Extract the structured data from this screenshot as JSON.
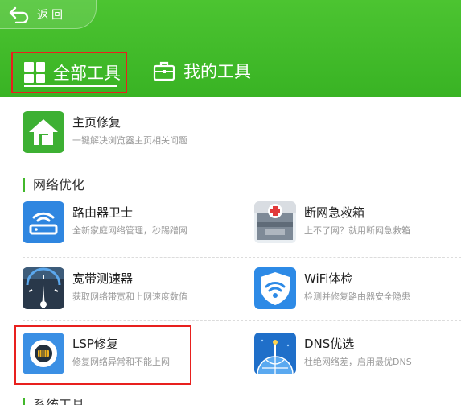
{
  "header": {
    "back_label": "返回",
    "tabs": [
      {
        "label": "全部工具",
        "selected": true
      },
      {
        "label": "我的工具",
        "selected": false
      }
    ]
  },
  "homepage_repair": {
    "name": "主页修复",
    "desc": "一键解决浏览器主页相关问题"
  },
  "sections": {
    "network": "网络优化",
    "system": "系统工具"
  },
  "network_tools": [
    {
      "name": "路由器卫士",
      "desc": "全新家庭网络管理，秒踢蹭网",
      "icon": "router-icon"
    },
    {
      "name": "断网急救箱",
      "desc": "上不了网？就用断网急救箱",
      "icon": "first-aid-kit-icon"
    },
    {
      "name": "宽带测速器",
      "desc": "获取网络带宽和上网速度数值",
      "icon": "speedometer-icon"
    },
    {
      "name": "WiFi体检",
      "desc": "检测并修复路由器安全隐患",
      "icon": "wifi-shield-icon"
    },
    {
      "name": "LSP修复",
      "desc": "修复网络异常和不能上网",
      "icon": "chip-icon"
    },
    {
      "name": "DNS优选",
      "desc": "杜绝网络差，启用最优DNS",
      "icon": "globe-icon"
    }
  ],
  "colors": {
    "header_green": "#3fb82a",
    "highlight_red": "#e8201e",
    "accent_blue": "#2f8de4"
  }
}
